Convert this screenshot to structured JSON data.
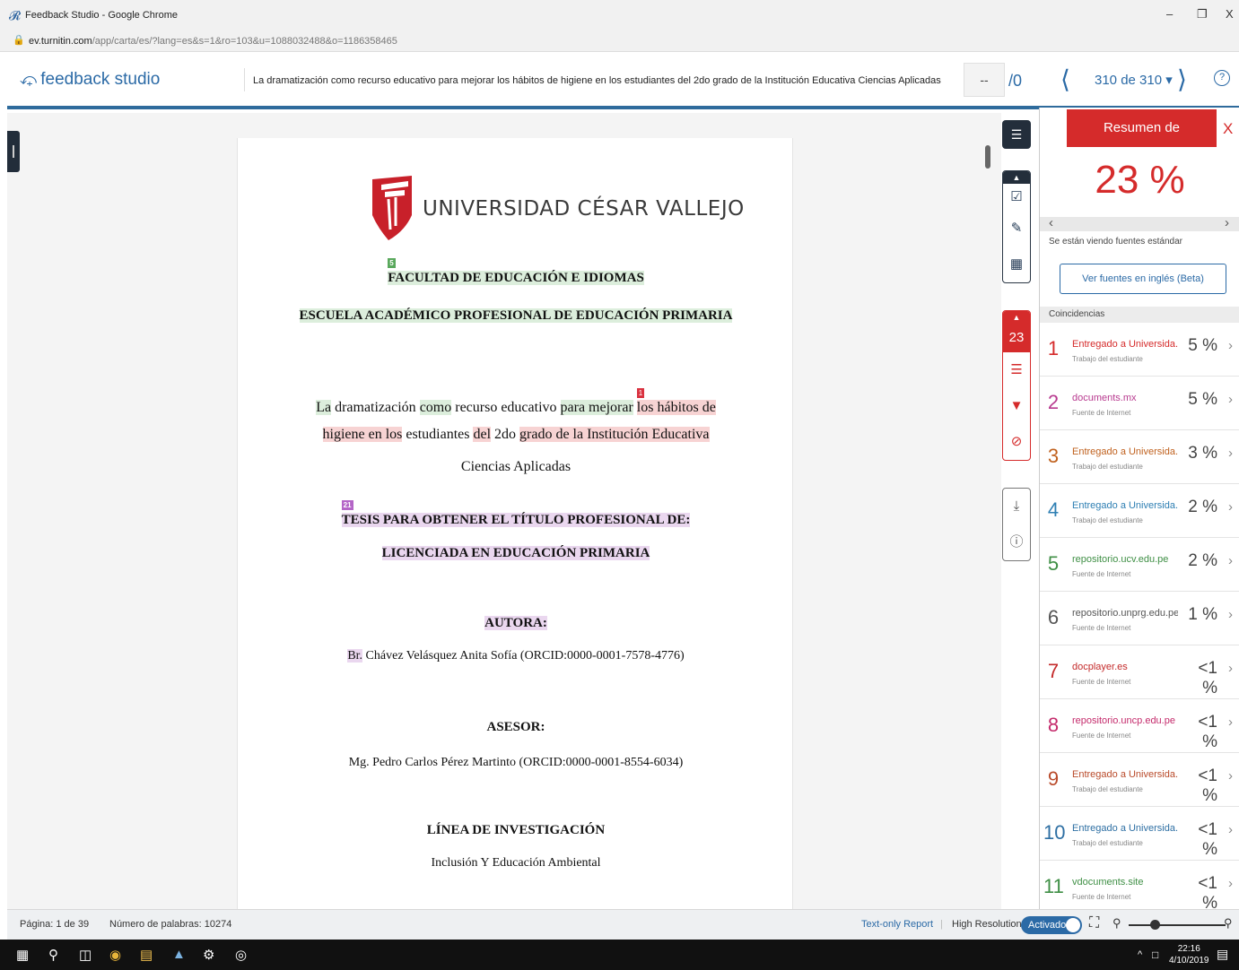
{
  "window": {
    "title": "Feedback Studio - Google Chrome",
    "url_host": "ev.turnitin.com",
    "url_path": "/app/carta/es/?lang=es&s=1&ro=103&u=1088032488&o=1186358465"
  },
  "header": {
    "logo_text": "feedback studio",
    "doc_title": "La dramatización como recurso educativo para mejorar los hábitos de higiene en los estudiantes del 2do grado de la Institución Educativa Ciencias Aplicadas",
    "grade_value": "--",
    "grade_of": "/0",
    "nav_count": "310 de 310 ▾",
    "help": "?"
  },
  "document": {
    "university": "UNIVERSIDAD CÉSAR VALLEJO",
    "faculty_tag": "5",
    "faculty": "FACULTAD DE EDUCACIÓN E IDIOMAS",
    "school": "ESCUELA ACADÉMICO PROFESIONAL DE EDUCACIÓN PRIMARIA",
    "title_tag": "1",
    "title_line1_parts": [
      "La",
      " dramatización ",
      "como",
      " recurso educativo ",
      "para mejorar",
      " ",
      "los hábitos de"
    ],
    "title_line2_parts": [
      "higiene en los",
      " estudiantes ",
      "del",
      " 2do ",
      "grado de la Institución Educativa"
    ],
    "title_line3": "Ciencias Aplicadas",
    "thesis_tag": "21",
    "thesis_line1": "TESIS PARA OBTENER EL TÍTULO PROFESIONAL DE:",
    "thesis_line2": "LICENCIADA EN EDUCACIÓN PRIMARIA",
    "author_label": "AUTORA:",
    "author_prefix": "Br.",
    "author_name": " Chávez Velásquez Anita Sofía (ORCID:0000-0001-7578-4776)",
    "advisor_label": "ASESOR:",
    "advisor_name": "Mg. Pedro Carlos Pérez Martinto (ORCID:0000-0001-8554-6034)",
    "research_label": "LÍNEA DE INVESTIGACIÓN",
    "research_name": "Inclusión Y Educación Ambiental"
  },
  "toolstrip": {
    "score": "23"
  },
  "panel": {
    "title": "Resumen de coincidencias",
    "close": "X",
    "percent": "23 %",
    "viewing": "Se están viendo fuentes estándar",
    "english_button": "Ver fuentes en inglés (Beta)",
    "section": "Coincidencias",
    "matches": [
      {
        "num": "1",
        "source": "Entregado a Universida...",
        "type": "Trabajo del estudiante",
        "pct": "5 %",
        "color": "#d52b2b"
      },
      {
        "num": "2",
        "source": "documents.mx",
        "type": "Fuente de Internet",
        "pct": "5 %",
        "color": "#b83a8f"
      },
      {
        "num": "3",
        "source": "Entregado a Universida...",
        "type": "Trabajo del estudiante",
        "pct": "3 %",
        "color": "#c0611e"
      },
      {
        "num": "4",
        "source": "Entregado a Universida...",
        "type": "Trabajo del estudiante",
        "pct": "2 %",
        "color": "#2e7fb3"
      },
      {
        "num": "5",
        "source": "repositorio.ucv.edu.pe",
        "type": "Fuente de Internet",
        "pct": "2 %",
        "color": "#3f8f45"
      },
      {
        "num": "6",
        "source": "repositorio.unprg.edu.pe",
        "type": "Fuente de Internet",
        "pct": "1 %",
        "color": "#555555"
      },
      {
        "num": "7",
        "source": "docplayer.es",
        "type": "Fuente de Internet",
        "pct": "<1 %",
        "color": "#c42a2a"
      },
      {
        "num": "8",
        "source": "repositorio.uncp.edu.pe",
        "type": "Fuente de Internet",
        "pct": "<1 %",
        "color": "#c42a6b"
      },
      {
        "num": "9",
        "source": "Entregado a Universida...",
        "type": "Trabajo del estudiante",
        "pct": "<1 %",
        "color": "#b94a2a"
      },
      {
        "num": "10",
        "source": "Entregado a Universida...",
        "type": "Trabajo del estudiante",
        "pct": "<1 %",
        "color": "#2e6fa3"
      },
      {
        "num": "11",
        "source": "vdocuments.site",
        "type": "Fuente de Internet",
        "pct": "<1 %",
        "color": "#3f8f45"
      }
    ]
  },
  "status": {
    "page": "Página: 1 de 39",
    "words": "Número de palabras: 10274",
    "text_only": "Text-only Report",
    "high_res": "High Resolution",
    "toggle": "Activado"
  },
  "taskbar": {
    "time": "22:16",
    "date": "4/10/2019"
  }
}
